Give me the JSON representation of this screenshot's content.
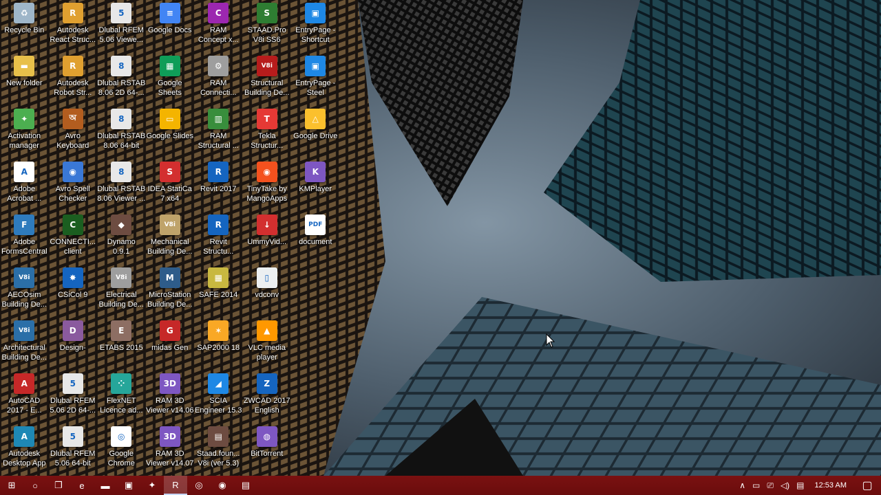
{
  "desktop_icons": [
    {
      "label": "Recycle Bin",
      "icon": "recycle-bin-icon",
      "color": "#9fb6c9",
      "glyph": "♻"
    },
    {
      "label": "New folder",
      "icon": "folder-icon",
      "color": "#e8c04a",
      "glyph": "▬"
    },
    {
      "label": "Activation\nmanager",
      "icon": "activation-manager-icon",
      "color": "#4caf50",
      "glyph": "✦"
    },
    {
      "label": "Adobe\nAcrobat ...",
      "icon": "adobe-acrobat-icon",
      "color": "#ffffff",
      "glyph": "A"
    },
    {
      "label": "Adobe\nFormsCentral",
      "icon": "adobe-formscentral-icon",
      "color": "#2e7bbd",
      "glyph": "F"
    },
    {
      "label": "AECOsim\nBuilding De...",
      "icon": "aecosim-icon",
      "color": "#2b6fa8",
      "glyph": "V8i"
    },
    {
      "label": "Architectural\nBuilding De...",
      "icon": "architectural-building-icon",
      "color": "#2b6fa8",
      "glyph": "V8i"
    },
    {
      "label": "AutoCAD\n2017 - E...",
      "icon": "autocad-icon",
      "color": "#c62828",
      "glyph": "A"
    },
    {
      "label": "Autodesk\nDesktop App",
      "icon": "autodesk-desktop-app-icon",
      "color": "#1e88b5",
      "glyph": "A"
    },
    {
      "label": "Autodesk\nReact Struc...",
      "icon": "autodesk-react-icon",
      "color": "#e0a030",
      "glyph": "R"
    },
    {
      "label": "Autodesk\nRobot Str...",
      "icon": "autodesk-robot-icon",
      "color": "#e0a030",
      "glyph": "R"
    },
    {
      "label": "Avro\nKeyboard",
      "icon": "avro-keyboard-icon",
      "color": "#b35d1f",
      "glyph": "অ"
    },
    {
      "label": "Avro Spell\nChecker",
      "icon": "avro-spell-checker-icon",
      "color": "#3a78d6",
      "glyph": "◉"
    },
    {
      "label": "CONNECTI...\nclient",
      "icon": "connect-client-icon",
      "color": "#1b5e20",
      "glyph": "C"
    },
    {
      "label": "CSiCol 9",
      "icon": "csicol-icon",
      "color": "#1565c0",
      "glyph": "✸"
    },
    {
      "label": "Design-",
      "icon": "design-icon",
      "color": "#8a5a9e",
      "glyph": "D"
    },
    {
      "label": "Dlubal RFEM\n5.06 2D 64-...",
      "icon": "dlubal-rfem-2d-icon",
      "color": "#e8e8e8",
      "glyph": "5"
    },
    {
      "label": "Dlubal RFEM\n5.06 64-bit",
      "icon": "dlubal-rfem-64-icon",
      "color": "#e8e8e8",
      "glyph": "5"
    },
    {
      "label": "Dlubal RFEM\n5.06 Viewe...",
      "icon": "dlubal-rfem-viewer-icon",
      "color": "#e8e8e8",
      "glyph": "5"
    },
    {
      "label": "Dlubal RSTAB\n8.06 2D 64-...",
      "icon": "dlubal-rstab-2d-icon",
      "color": "#e8e8e8",
      "glyph": "8"
    },
    {
      "label": "Dlubal RSTAB\n8.06 64-bit",
      "icon": "dlubal-rstab-64-icon",
      "color": "#e8e8e8",
      "glyph": "8"
    },
    {
      "label": "Dlubal RSTAB\n8.06 Viewer ...",
      "icon": "dlubal-rstab-viewer-icon",
      "color": "#e8e8e8",
      "glyph": "8"
    },
    {
      "label": "Dynamo\n0.9.1",
      "icon": "dynamo-icon",
      "color": "#6d4c41",
      "glyph": "◆"
    },
    {
      "label": "Electrical\nBuilding De...",
      "icon": "electrical-building-icon",
      "color": "#9e9e9e",
      "glyph": "V8i"
    },
    {
      "label": "ETABS 2015",
      "icon": "etabs-icon",
      "color": "#8d6e63",
      "glyph": "E"
    },
    {
      "label": "FlexNET\nLicence ad...",
      "icon": "flexnet-icon",
      "color": "#26a69a",
      "glyph": "⁘"
    },
    {
      "label": "Google\nChrome",
      "icon": "google-chrome-icon",
      "color": "#ffffff",
      "glyph": "◎"
    },
    {
      "label": "Google Docs",
      "icon": "google-docs-icon",
      "color": "#4285f4",
      "glyph": "≡"
    },
    {
      "label": "Google\nSheets",
      "icon": "google-sheets-icon",
      "color": "#0f9d58",
      "glyph": "▦"
    },
    {
      "label": "Google Slides",
      "icon": "google-slides-icon",
      "color": "#f4b400",
      "glyph": "▭"
    },
    {
      "label": "IDEA StatiCa\n7 x64",
      "icon": "idea-statica-icon",
      "color": "#d32f2f",
      "glyph": "S"
    },
    {
      "label": "Mechanical\nBuilding De...",
      "icon": "mechanical-building-icon",
      "color": "#bfa36a",
      "glyph": "V8i"
    },
    {
      "label": "MicroStation\nBuilding De...",
      "icon": "microstation-building-icon",
      "color": "#2e5c8a",
      "glyph": "M"
    },
    {
      "label": "midas Gen",
      "icon": "midas-gen-icon",
      "color": "#c62828",
      "glyph": "G"
    },
    {
      "label": "RAM 3D\nViewer v14.06",
      "icon": "ram-3d-viewer-1406-icon",
      "color": "#7e57c2",
      "glyph": "3D"
    },
    {
      "label": "RAM 3D\nViewer v14.07",
      "icon": "ram-3d-viewer-1407-icon",
      "color": "#7e57c2",
      "glyph": "3D"
    },
    {
      "label": "RAM\nConcept x...",
      "icon": "ram-concept-icon",
      "color": "#9c27b0",
      "glyph": "C"
    },
    {
      "label": "RAM\nConnecti...",
      "icon": "ram-connection-icon",
      "color": "#9e9e9e",
      "glyph": "⚙"
    },
    {
      "label": "RAM\nStructural ...",
      "icon": "ram-structural-icon",
      "color": "#388e3c",
      "glyph": "▥"
    },
    {
      "label": "Revit 2017",
      "icon": "revit-2017-icon",
      "color": "#1565c0",
      "glyph": "R"
    },
    {
      "label": "Revit\nStructu...",
      "icon": "revit-structure-icon",
      "color": "#1565c0",
      "glyph": "R"
    },
    {
      "label": "SAFE 2014",
      "icon": "safe-2014-icon",
      "color": "#c8b840",
      "glyph": "▦"
    },
    {
      "label": "SAP2000 18",
      "icon": "sap2000-icon",
      "color": "#f9a825",
      "glyph": "✶"
    },
    {
      "label": "SCIA\nEngineer 15.3",
      "icon": "scia-engineer-icon",
      "color": "#1e88e5",
      "glyph": "◢"
    },
    {
      "label": "Staad.foun...\nV8i (ver 5.3)",
      "icon": "staad-foundation-icon",
      "color": "#6d4c41",
      "glyph": "▤"
    },
    {
      "label": "STAAD.Pro\nV8i SS6",
      "icon": "staad-pro-icon",
      "color": "#2e7d32",
      "glyph": "S"
    },
    {
      "label": "Structural\nBuilding De...",
      "icon": "structural-building-icon",
      "color": "#b71c1c",
      "glyph": "V8i"
    },
    {
      "label": "Tekla\nStructur...",
      "icon": "tekla-structures-icon",
      "color": "#e53935",
      "glyph": "T"
    },
    {
      "label": "TinyTake by\nMangoApps",
      "icon": "tinytake-icon",
      "color": "#f4511e",
      "glyph": "◉"
    },
    {
      "label": "UmmyVid...",
      "icon": "ummy-video-icon",
      "color": "#d32f2f",
      "glyph": "↓"
    },
    {
      "label": "vdconv",
      "icon": "vdconv-icon",
      "color": "#eceff1",
      "glyph": "▯"
    },
    {
      "label": "VLC media\nplayer",
      "icon": "vlc-icon",
      "color": "#ff9800",
      "glyph": "▲"
    },
    {
      "label": "ZWCAD 2017\nEnglish",
      "icon": "zwcad-icon",
      "color": "#1565c0",
      "glyph": "Z"
    },
    {
      "label": "BitTorrent",
      "icon": "bittorrent-icon",
      "color": "#7e57c2",
      "glyph": "◍"
    },
    {
      "label": "EntryPage -\nShortcut",
      "icon": "entrypage-shortcut-icon",
      "color": "#1e88e5",
      "glyph": "▣"
    },
    {
      "label": "EntryPage -\nSteel",
      "icon": "entrypage-steel-icon",
      "color": "#1e88e5",
      "glyph": "▣"
    },
    {
      "label": "Google Drive",
      "icon": "google-drive-icon",
      "color": "#fbc02d",
      "glyph": "△"
    },
    {
      "label": "KMPlayer",
      "icon": "kmplayer-icon",
      "color": "#7e57c2",
      "glyph": "K"
    },
    {
      "label": "document",
      "icon": "pdf-document-icon",
      "color": "#ffffff",
      "glyph": "PDF"
    }
  ],
  "taskbar": {
    "pinned": [
      {
        "name": "start-button",
        "glyph": "⊞",
        "active": false
      },
      {
        "name": "cortana-button",
        "glyph": "○",
        "active": false
      },
      {
        "name": "task-view-button",
        "glyph": "❐",
        "active": false
      },
      {
        "name": "edge-taskbar-icon",
        "glyph": "e",
        "active": false
      },
      {
        "name": "file-explorer-taskbar-icon",
        "glyph": "▬",
        "active": false
      },
      {
        "name": "store-taskbar-icon",
        "glyph": "▣",
        "active": false
      },
      {
        "name": "app-taskbar-icon",
        "glyph": "✦",
        "active": false
      },
      {
        "name": "robot-taskbar-icon",
        "glyph": "R",
        "active": true
      },
      {
        "name": "chrome-taskbar-icon",
        "glyph": "◎",
        "active": false
      },
      {
        "name": "tinytake-taskbar-icon",
        "glyph": "◉",
        "active": false
      },
      {
        "name": "notepad-taskbar-icon",
        "glyph": "▤",
        "active": false
      }
    ],
    "tray": {
      "chevron": "∧",
      "clock": "12:53 AM"
    }
  },
  "colors": {
    "taskbar": "#7a1111",
    "sky": "#6e7f8e"
  }
}
